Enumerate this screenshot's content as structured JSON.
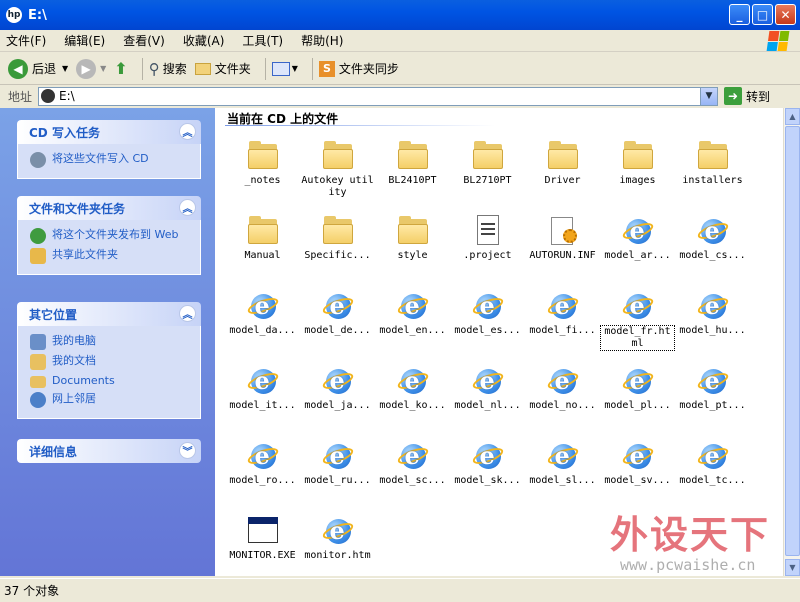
{
  "window": {
    "title": "E:\\",
    "title_icon": "hp-drive-icon"
  },
  "window_buttons": {
    "minimize": "_",
    "maximize": "□",
    "close": "✕"
  },
  "menu": [
    "文件(F)",
    "编辑(E)",
    "查看(V)",
    "收藏(A)",
    "工具(T)",
    "帮助(H)"
  ],
  "toolbar": {
    "back": "后退",
    "search": "搜索",
    "folders": "文件夹",
    "sync": "文件夹同步"
  },
  "address": {
    "label": "地址",
    "value": "E:\\",
    "go": "转到"
  },
  "panels": [
    {
      "title": "CD 写入任务",
      "items": [
        {
          "label": "将这些文件写入 CD",
          "icon": "cd-write-icon",
          "color": "#7A8FA8"
        }
      ]
    },
    {
      "title": "文件和文件夹任务",
      "items": [
        {
          "label": "将这个文件夹发布到 Web",
          "icon": "publish-web-icon",
          "color": "#3F9B3F"
        },
        {
          "label": "共享此文件夹",
          "icon": "share-folder-icon",
          "color": "#E8B84A"
        }
      ]
    },
    {
      "title": "其它位置",
      "items": [
        {
          "label": "我的电脑",
          "icon": "my-computer-icon",
          "color": "#6A8FC8"
        },
        {
          "label": "我的文档",
          "icon": "my-documents-icon",
          "color": "#E8C060"
        },
        {
          "label": "Documents",
          "icon": "folder-icon",
          "color": "#E8C060"
        },
        {
          "label": "网上邻居",
          "icon": "network-icon",
          "color": "#4B7FC8"
        }
      ]
    },
    {
      "title": "详细信息",
      "items": []
    }
  ],
  "content": {
    "heading": "当前在 CD 上的文件",
    "files": [
      {
        "name": "_notes",
        "type": "folder"
      },
      {
        "name": "Autokey utility",
        "type": "folder"
      },
      {
        "name": "BL2410PT",
        "type": "folder"
      },
      {
        "name": "BL2710PT",
        "type": "folder"
      },
      {
        "name": "Driver",
        "type": "folder"
      },
      {
        "name": "images",
        "type": "folder"
      },
      {
        "name": "installers",
        "type": "folder"
      },
      {
        "name": "Manual",
        "type": "folder"
      },
      {
        "name": "Specific...",
        "type": "folder"
      },
      {
        "name": "style",
        "type": "folder"
      },
      {
        "name": ".project",
        "type": "doc"
      },
      {
        "name": "AUTORUN.INF",
        "type": "inf"
      },
      {
        "name": "model_ar...",
        "type": "ie"
      },
      {
        "name": "model_cs...",
        "type": "ie"
      },
      {
        "name": "model_da...",
        "type": "ie"
      },
      {
        "name": "model_de...",
        "type": "ie"
      },
      {
        "name": "model_en...",
        "type": "ie"
      },
      {
        "name": "model_es...",
        "type": "ie"
      },
      {
        "name": "model_fi...",
        "type": "ie"
      },
      {
        "name": "model_fr.html",
        "type": "ie",
        "selected": true
      },
      {
        "name": "model_hu...",
        "type": "ie"
      },
      {
        "name": "model_it...",
        "type": "ie"
      },
      {
        "name": "model_ja...",
        "type": "ie"
      },
      {
        "name": "model_ko...",
        "type": "ie"
      },
      {
        "name": "model_nl...",
        "type": "ie"
      },
      {
        "name": "model_no...",
        "type": "ie"
      },
      {
        "name": "model_pl...",
        "type": "ie"
      },
      {
        "name": "model_pt...",
        "type": "ie"
      },
      {
        "name": "model_ro...",
        "type": "ie"
      },
      {
        "name": "model_ru...",
        "type": "ie"
      },
      {
        "name": "model_sc...",
        "type": "ie"
      },
      {
        "name": "model_sk...",
        "type": "ie"
      },
      {
        "name": "model_sl...",
        "type": "ie"
      },
      {
        "name": "model_sv...",
        "type": "ie"
      },
      {
        "name": "model_tc...",
        "type": "ie"
      },
      {
        "name": "MONITOR.EXE",
        "type": "exe"
      },
      {
        "name": "monitor.htm",
        "type": "ie"
      }
    ]
  },
  "status": "37 个对象",
  "watermark": {
    "title": "外设天下",
    "url": "www.pcwaishe.cn"
  }
}
